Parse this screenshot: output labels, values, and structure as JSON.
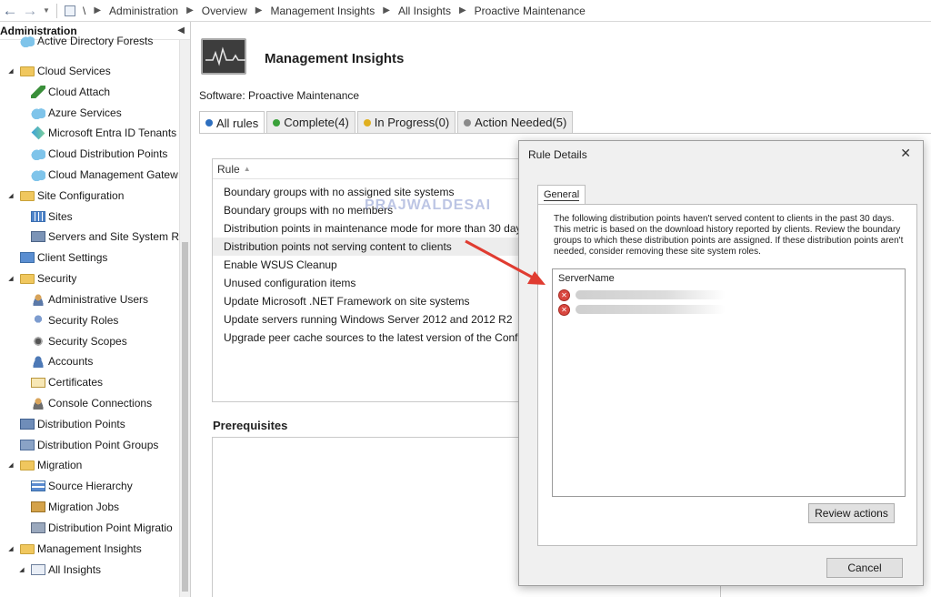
{
  "address_bar": {
    "root": "\\",
    "breadcrumbs": [
      "Administration",
      "Overview",
      "Management Insights",
      "All Insights",
      "Proactive Maintenance"
    ]
  },
  "sidebar": {
    "title": "Administration",
    "items": [
      {
        "label": "Active Directory Forests",
        "icon": "forest-icon"
      },
      {
        "label": "Cloud Services",
        "icon": "folder-icon"
      },
      {
        "label": "Cloud Attach",
        "icon": "plug-icon"
      },
      {
        "label": "Azure Services",
        "icon": "cloud-icon"
      },
      {
        "label": "Microsoft Entra ID Tenants",
        "icon": "entra-icon"
      },
      {
        "label": "Cloud Distribution Points",
        "icon": "cloud-icon"
      },
      {
        "label": "Cloud Management Gatew",
        "icon": "cloud-icon"
      },
      {
        "label": "Site Configuration",
        "icon": "folder-icon"
      },
      {
        "label": "Sites",
        "icon": "grid-icon"
      },
      {
        "label": "Servers and Site System Ro",
        "icon": "server-icon"
      },
      {
        "label": "Client Settings",
        "icon": "settings-icon"
      },
      {
        "label": "Security",
        "icon": "folder-icon"
      },
      {
        "label": "Administrative Users",
        "icon": "users-icon"
      },
      {
        "label": "Security Roles",
        "icon": "roles-icon"
      },
      {
        "label": "Security Scopes",
        "icon": "scope-icon"
      },
      {
        "label": "Accounts",
        "icon": "account-icon"
      },
      {
        "label": "Certificates",
        "icon": "certificate-icon"
      },
      {
        "label": "Console Connections",
        "icon": "console-icon"
      },
      {
        "label": "Distribution Points",
        "icon": "distribution-point-icon"
      },
      {
        "label": "Distribution Point Groups",
        "icon": "distribution-group-icon"
      },
      {
        "label": "Migration",
        "icon": "folder-icon"
      },
      {
        "label": "Source Hierarchy",
        "icon": "hierarchy-icon"
      },
      {
        "label": "Migration Jobs",
        "icon": "jobs-icon"
      },
      {
        "label": "Distribution Point Migratio",
        "icon": "dp-migration-icon"
      },
      {
        "label": "Management Insights",
        "icon": "folder-icon"
      },
      {
        "label": "All Insights",
        "icon": "insight-icon"
      }
    ]
  },
  "main": {
    "title": "Management Insights",
    "software_label": "Software: Proactive Maintenance",
    "tabs": [
      {
        "label": "All rules",
        "color": "#2e6fbf"
      },
      {
        "label": "Complete(4)",
        "color": "#3aa13a"
      },
      {
        "label": "In Progress(0)",
        "color": "#e0b020"
      },
      {
        "label": "Action Needed(5)",
        "color": "#8a8a8a"
      }
    ],
    "rule_column": "Rule",
    "rules": [
      "Boundary groups with no assigned site systems",
      "Boundary groups with no members",
      "Distribution points in maintenance mode for more than 30 days",
      "Distribution points not serving content to clients",
      "Enable WSUS Cleanup",
      "Unused configuration items",
      "Update Microsoft .NET Framework on site systems",
      "Update servers running Windows Server 2012 and 2012 R2",
      "Upgrade peer cache sources to the latest version of the Config..."
    ],
    "selected_rule_index": 3,
    "prerequisites_title": "Prerequisites",
    "watermark": "PRAJWALDESAI"
  },
  "dialog": {
    "title": "Rule Details",
    "tab": "General",
    "description": "The following distribution points haven't served content to clients in the past 30 days. This metric is based on the download history reported by clients. Review the boundary groups to which these distribution points are assigned. If these distribution points aren't needed, consider removing these site system roles.",
    "column": "ServerName",
    "servers": [
      "",
      ""
    ],
    "review_button": "Review actions",
    "cancel_button": "Cancel",
    "error_color": "#d9473f"
  },
  "annotation": {
    "arrow_color": "#e03c31"
  }
}
